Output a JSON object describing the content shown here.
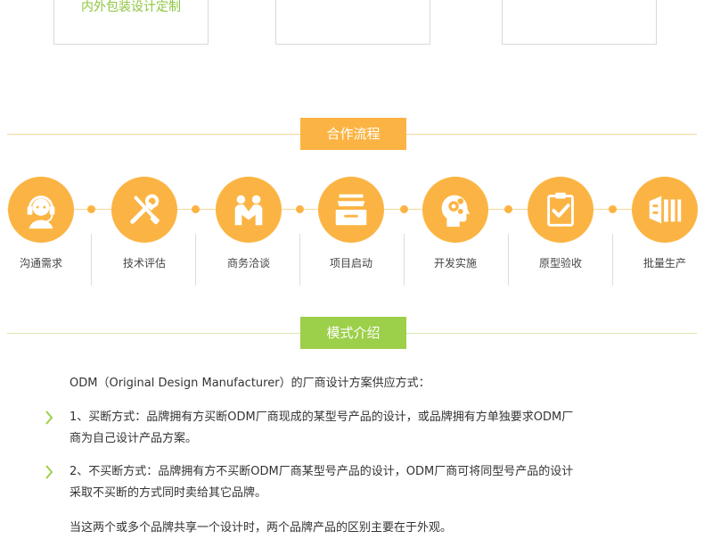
{
  "colors": {
    "orange": "#fbb443",
    "green": "#9ccf4a",
    "line_orange": "#f4d79a",
    "line_green": "#d7e9a9",
    "top_label_green": "#8dc63f"
  },
  "top_boxes": [
    {
      "label": "内外包装设计定制"
    },
    {
      "label": ""
    },
    {
      "label": ""
    }
  ],
  "process": {
    "title": "合作流程",
    "steps": [
      {
        "label": "沟通需求",
        "icon": "headset-icon"
      },
      {
        "label": "技术评估",
        "icon": "tools-icon"
      },
      {
        "label": "商务洽谈",
        "icon": "handshake-icon"
      },
      {
        "label": "项目启动",
        "icon": "tray-icon"
      },
      {
        "label": "开发实施",
        "icon": "gear-head-icon"
      },
      {
        "label": "原型验收",
        "icon": "clipboard-check-icon"
      },
      {
        "label": "批量生产",
        "icon": "production-icon"
      }
    ]
  },
  "mode": {
    "title": "模式介绍",
    "intro": "ODM（Original Design Manufacturer）的厂商设计方案供应方式：",
    "items": [
      {
        "line1": "1、买断方式：品牌拥有方买断ODM厂商现成的某型号产品的设计，或品牌拥有方单独要求ODM厂",
        "line2": "商为自己设计产品方案。"
      },
      {
        "line1": "2、不买断方式：品牌拥有方不买断ODM厂商某型号产品的设计，ODM厂商可将同型号产品的设计",
        "line2": "采取不买断的方式同时卖给其它品牌。"
      }
    ],
    "footer": "当这两个或多个品牌共享一个设计时，两个品牌产品的区别主要在于外观。"
  }
}
